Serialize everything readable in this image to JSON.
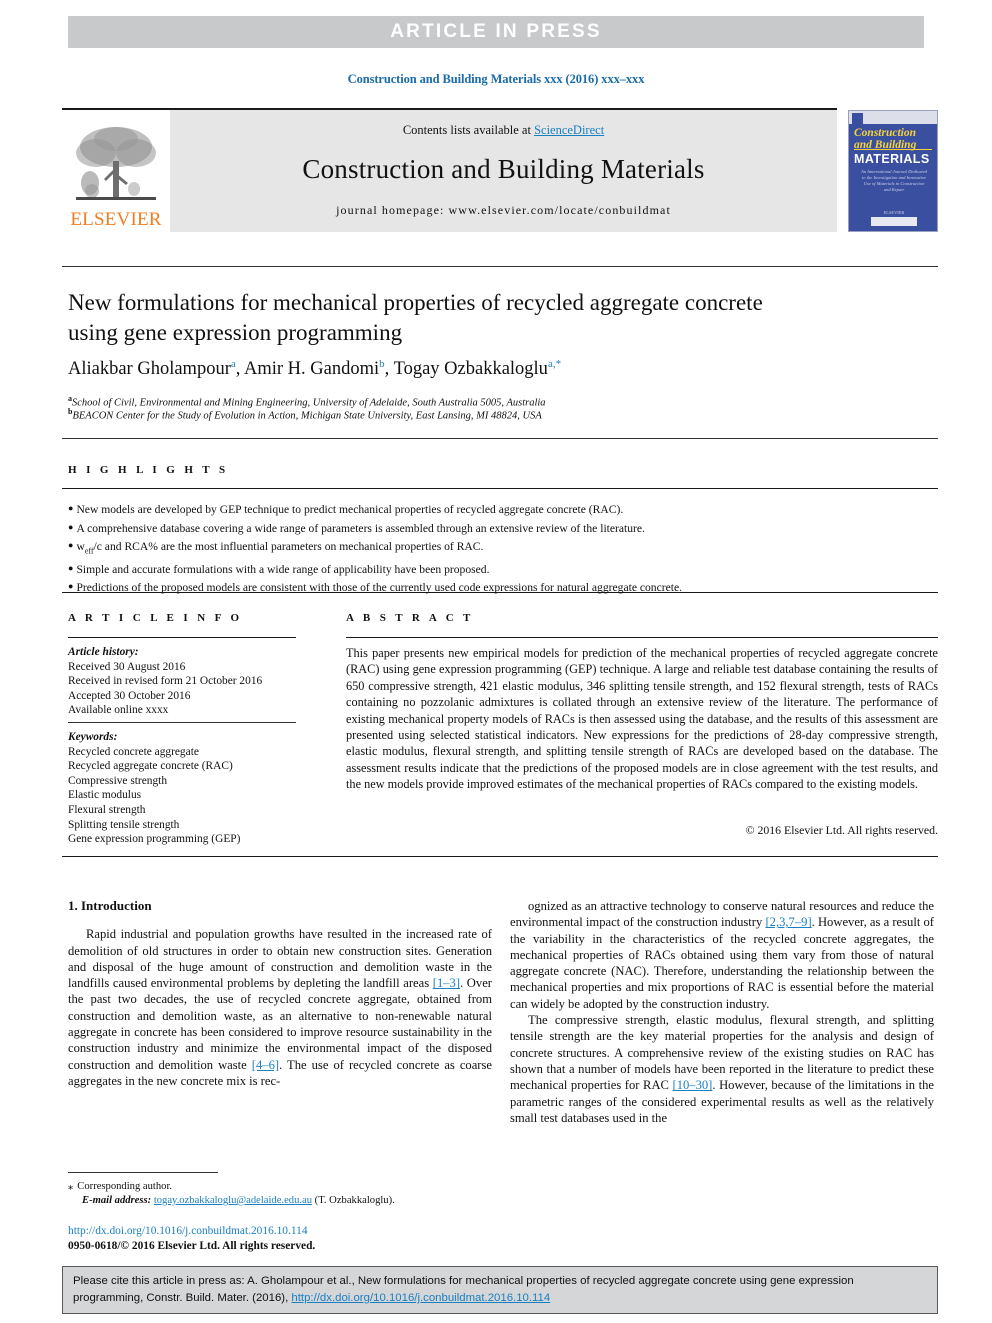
{
  "banner": {
    "text": "ARTICLE  IN  PRESS"
  },
  "journal_ref": "Construction and Building Materials xxx (2016) xxx–xxx",
  "masthead": {
    "contents_prefix": "Contents lists available at ",
    "sciencedirect": "ScienceDirect",
    "journal_title": "Construction and Building Materials",
    "homepage": "journal homepage: www.elsevier.com/locate/conbuildmat",
    "publisher_wordmark": "ELSEVIER"
  },
  "cover": {
    "line1": "Construction",
    "line2": "and Building",
    "line3": "MATERIALS",
    "blurb": "An International Journal Dedicated to the Investigation and Innovative Use of Materials in Construction and Repair",
    "footer": "ELSEVIER"
  },
  "article": {
    "title": "New formulations for mechanical properties of recycled aggregate concrete using gene expression programming",
    "authors": [
      {
        "name": "Aliakbar Gholampour",
        "sup": "a"
      },
      {
        "name": "Amir H. Gandomi",
        "sup": "b"
      },
      {
        "name": "Togay Ozbakkaloglu",
        "sup": "a,*"
      }
    ],
    "affiliations": [
      {
        "marker": "a",
        "text": "School of Civil, Environmental and Mining Engineering, University of Adelaide, South Australia 5005, Australia"
      },
      {
        "marker": "b",
        "text": "BEACON Center for the Study of Evolution in Action, Michigan State University, East Lansing, MI 48824, USA"
      }
    ]
  },
  "highlights": {
    "label": "H I G H L I G H T S",
    "items": [
      "New models are developed by GEP technique to predict mechanical properties of recycled aggregate concrete (RAC).",
      "A comprehensive database covering a wide range of parameters is assembled through an extensive review of the literature.",
      "weff/c and RCA% are the most influential parameters on mechanical properties of RAC.",
      "Simple and accurate formulations with a wide range of applicability have been proposed.",
      "Predictions of the proposed models are consistent with those of the currently used code expressions for natural aggregate concrete."
    ],
    "item3_pre": "w",
    "item3_sub": "eff",
    "item3_post": "/c and RCA% are the most influential parameters on mechanical properties of RAC."
  },
  "article_info": {
    "label": "A R T I C L E    I N F O",
    "history_head": "Article history:",
    "history": [
      "Received 30 August 2016",
      "Received in revised form 21 October 2016",
      "Accepted 30 October 2016",
      "Available online xxxx"
    ],
    "keywords_head": "Keywords:",
    "keywords": [
      "Recycled concrete aggregate",
      "Recycled aggregate concrete (RAC)",
      "Compressive strength",
      "Elastic modulus",
      "Flexural strength",
      "Splitting tensile strength",
      "Gene expression programming (GEP)"
    ]
  },
  "abstract": {
    "label": "A B S T R A C T",
    "text": "This paper presents new empirical models for prediction of the mechanical properties of recycled aggregate concrete (RAC) using gene expression programming (GEP) technique. A large and reliable test database containing the results of 650 compressive strength, 421 elastic modulus, 346 splitting tensile strength, and 152 flexural strength, tests of RACs containing no pozzolanic admixtures is collated through an extensive review of the literature. The performance of existing mechanical property models of RACs is then assessed using the database, and the results of this assessment are presented using selected statistical indicators. New expressions for the predictions of 28-day compressive strength, elastic modulus, flexural strength, and splitting tensile strength of RACs are developed based on the database. The assessment results indicate that the predictions of the proposed models are in close agreement with the test results, and the new models provide improved estimates of the mechanical properties of RACs compared to the existing models.",
    "copyright": "© 2016 Elsevier Ltd. All rights reserved."
  },
  "body": {
    "section_heading": "1. Introduction",
    "left_p1_a": "Rapid industrial and population growths have resulted in the increased rate of demolition of old structures in order to obtain new construction sites. Generation and disposal of the huge amount of construction and demolition waste in the landfills caused environmental problems by depleting the landfill areas ",
    "left_cite1": "[1–3]",
    "left_p1_b": ". Over the past two decades, the use of recycled concrete aggregate, obtained from construction and demolition waste, as an alternative to non-renewable natural aggregate in concrete has been considered to improve resource sustainability in the construction industry and minimize the environmental impact of the disposed construction and demolition waste ",
    "left_cite2": "[4–6]",
    "left_p1_c": ". The use of recycled concrete as coarse aggregates in the new concrete mix is rec-",
    "right_p1_a": "ognized as an attractive technology to conserve natural resources and reduce the environmental impact of the construction industry ",
    "right_cite1": "[2,3,7–9]",
    "right_p1_b": ". However, as a result of the variability in the characteristics of the recycled concrete aggregates, the mechanical properties of RACs obtained using them vary from those of natural aggregate concrete (NAC). Therefore, understanding the relationship between the mechanical properties and mix proportions of RAC is essential before the material can widely be adopted by the construction industry.",
    "right_p2_a": "The compressive strength, elastic modulus, flexural strength, and splitting tensile strength are the key material properties for the analysis and design of concrete structures. A comprehensive review of the existing studies on RAC has shown that a number of models have been reported in the literature to predict these mechanical properties for RAC ",
    "right_cite2": "[10–30]",
    "right_p2_b": ". However, because of the limitations in the parametric ranges of the considered experimental results as well as the relatively small test databases used in the"
  },
  "footnote": {
    "star": "⁎",
    "corresponding": "Corresponding author.",
    "email_label": "E-mail address:",
    "email": "togay.ozbakkaloglu@adelaide.edu.au",
    "email_owner": "(T. Ozbakkaloglu).",
    "doi": "http://dx.doi.org/10.1016/j.conbuildmat.2016.10.114",
    "issn": "0950-0618/© 2016 Elsevier Ltd. All rights reserved."
  },
  "cite_box": {
    "text_a": "Please cite this article in press as: A. Gholampour et al., New formulations for mechanical properties of recycled aggregate concrete using gene expression programming, Constr. Build. Mater. (2016), ",
    "link": "http://dx.doi.org/10.1016/j.conbuildmat.2016.10.114"
  },
  "colors": {
    "link_blue": "#1a7fc1",
    "banner_gray": "#c8c9cb",
    "elsevier_orange": "#ef7d22",
    "cover_blue": "#3b4fa0"
  }
}
